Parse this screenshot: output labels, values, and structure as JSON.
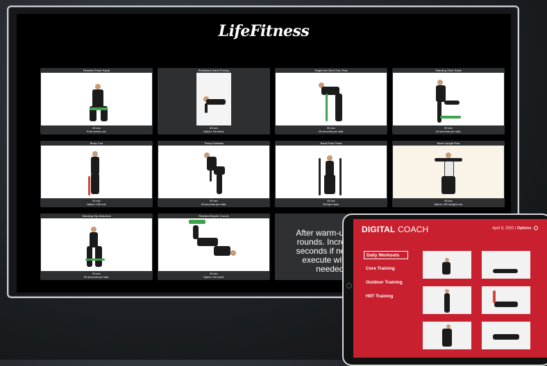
{
  "monitor": {
    "logo": "LifeFitness",
    "cards": [
      {
        "title": "Resisted Pulse Squat",
        "detail1": "45 sec",
        "detail2": "Push knees out."
      },
      {
        "title": "Resistance Band Pushup",
        "detail1": "45 sec",
        "detail2": "Option: No band."
      },
      {
        "title": "Single Arm Bent Over Row",
        "detail1": "90 sec",
        "detail2": "45 seconds per side."
      },
      {
        "title": "Standing Glute Raise",
        "detail1": "90 sec",
        "detail2": "45 seconds per side."
      },
      {
        "title": "Bicep Curl",
        "detail1": "45 sec",
        "detail2": "Option: DB curl."
      },
      {
        "title": "Tricep Kickback",
        "detail1": "90 sec",
        "detail2": "45 seconds per side."
      },
      {
        "title": "Band Push Press",
        "detail1": "45 sec",
        "detail2": "Sit hips back."
      },
      {
        "title": "Band Upright Row",
        "detail1": "45 sec",
        "detail2": "Option: DB Upright row."
      },
      {
        "title": "Standing Hip Abduction",
        "detail1": "90 sec",
        "detail2": "45 seconds per side."
      },
      {
        "title": "Resisted Bicycle Crunch",
        "detail1": "45 sec",
        "detail2": "Option: No band."
      }
    ],
    "message": [
      "After warm-up com",
      "rounds. Increase ti",
      "seconds if needed.",
      "execute without",
      "needed."
    ]
  },
  "tablet": {
    "brand_bold": "DIGITAL",
    "brand_light": "COACH",
    "date": "April 8, 2020",
    "separator": "|",
    "options_label": "Options",
    "icons": {
      "options": "gear-icon"
    },
    "menu": [
      "Daily Workouts",
      "Core Training",
      "Outdoor Training",
      "HIIT Training"
    ],
    "active_menu": "Daily Workouts"
  },
  "colors": {
    "tablet_bg": "#c8202e",
    "card_bg": "#2e2f31",
    "band_green": "#3fa34d"
  }
}
